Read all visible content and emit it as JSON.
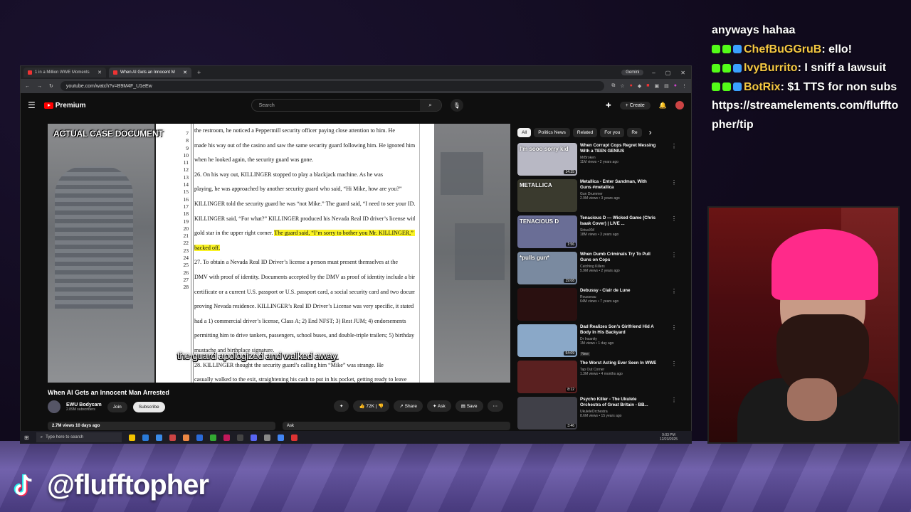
{
  "browser": {
    "tabs": [
      {
        "label": "1 in a Million WWE Moments",
        "active": false
      },
      {
        "label": "When AI Gets an Innocent M",
        "active": true
      }
    ],
    "gemini_label": "Gemini",
    "url": "youtube.com/watch?v=B9M4F_U1eEw"
  },
  "youtube": {
    "premium_label": "Premium",
    "search_placeholder": "Search",
    "create_label": "Create"
  },
  "video": {
    "overlay_label": "ACTUAL CASE DOCUMENT",
    "caption": "the guard apologized and walked away.",
    "document_line_numbers": [
      "7",
      "8",
      "9",
      "10",
      "11",
      "12",
      "13",
      "14",
      "15",
      "16",
      "17",
      "18",
      "19",
      "20",
      "21",
      "22",
      "23",
      "24",
      "25",
      "26",
      "27",
      "28"
    ],
    "document_lines": [
      {
        "text": "the restroom, he noticed a Peppermill security officer paying close attention to him. He",
        "hl": false
      },
      {
        "text": "made his way out of the casino and saw the same security guard following him. He ignored him and",
        "hl": false
      },
      {
        "text": "when he looked again, the security guard was gone.",
        "hl": false
      },
      {
        "text": "        26.    On his way out, KILLINGER stopped to play a blackjack machine. As he was",
        "hl": false
      },
      {
        "text": "playing, he was approached by another security guard who said, “Hi Mike, how are you?”",
        "hl": false
      },
      {
        "text": "KILLINGER told the security guard he was “not Mike.” The guard said, “I need to see your ID.”",
        "hl": false
      },
      {
        "text": "KILLINGER said, “For what?” KILLINGER produced his Nevada Real ID driver’s license with the",
        "hl": false
      },
      {
        "text": "gold star in the upper right corner. ",
        "hl_tail": "The guard said, “I’m sorry to bother you Mr. KILLINGER,” and"
      },
      {
        "text": "",
        "hl_tail": "backed off."
      },
      {
        "text": "        27.    To obtain a Nevada Real ID Driver’s license a person must present themselves at the",
        "hl": false
      },
      {
        "text": "DMV with proof of identity. Documents accepted by the DMV as proof of identity include a birth",
        "hl": false
      },
      {
        "text": "certificate or a current U.S. passport or U.S. passport card, a social security card and two documents",
        "hl": false
      },
      {
        "text": "proving Nevada residence. KILLINGER’s Real ID Driver’s License was very specific, it stated he",
        "hl": false
      },
      {
        "text": "had a 1) commercial driver’s license, Class A; 2) End NFST; 3) Rest JUM; 4) endorsements",
        "hl": false
      },
      {
        "text": "permitting him to drive tankers, passengers, school buses, and double-triple trailers; 5) birthday on",
        "hl": false
      },
      {
        "text": "                        mustache and birthplace signature.",
        "hl": false
      },
      {
        "text": "        28.    KILLINGER thought the security guard’s calling him “Mike” was strange. He",
        "hl": false
      },
      {
        "text": "casually walked to the exit, straightening his cash to put in his pocket, getting ready to leave",
        "hl": false
      }
    ],
    "title": "When AI Gets an Innocent Man Arrested",
    "channel": "EWU Bodycam",
    "subscribers": "2.89M subscribers",
    "join_label": "Join",
    "subscribe_label": "Subscribe",
    "likes": "72K",
    "share_label": "Share",
    "ask_label": "Ask",
    "save_label": "Save",
    "views_line": "2.7M views  10 days ago",
    "ask_bar": "Ask"
  },
  "chips": [
    "All",
    "Politics News",
    "Related",
    "For you",
    "Re"
  ],
  "recommendations": [
    {
      "title": "When Corrupt Cops Regret Messing With a TEEN GENIUS",
      "channel": "MrBroken",
      "meta": "11M views • 2 years ago",
      "duration": "14:35",
      "thumb_color": "#b8b8c4",
      "thumb_text": "I'm sooo sorry kid"
    },
    {
      "title": "Metallica - Enter Sandman, With Guns #metallica",
      "channel": "Gun Drummer",
      "meta": "2.9M views • 3 years ago",
      "duration": "",
      "thumb_color": "#3a3a2e",
      "thumb_text": "METALLICA"
    },
    {
      "title": "Tenacious D — Wicked Game (Chris Isaak Cover) | LIVE ...",
      "channel": "SiriusXM",
      "meta": "18M views • 3 years ago",
      "duration": "1:56",
      "thumb_color": "#6a6e96",
      "thumb_text": "TENACIOUS D"
    },
    {
      "title": "When Dumb Criminals Try To Pull Guns on Cops",
      "channel": "Catching Killers",
      "meta": "5.9M views • 2 years ago",
      "duration": "19:08",
      "thumb_color": "#7a8aa0",
      "thumb_text": "*pulls gun*"
    },
    {
      "title": "Debussy - Clair de Lune",
      "channel": "Rousseau",
      "meta": "64M views • 7 years ago",
      "duration": "",
      "thumb_color": "#2a1010",
      "thumb_text": ""
    },
    {
      "title": "Dad Realizes Son's Girlfriend Hid A Body In His Backyard",
      "channel": "Dr Insanity",
      "meta": "1M views • 1 day ago",
      "duration": "54:09",
      "thumb_color": "#8aa8c8",
      "thumb_text": "",
      "badge": "New"
    },
    {
      "title": "The Worst Acting Ever Seen In WWE",
      "channel": "Tap Out Corner",
      "meta": "1.3M views • 4 months ago",
      "duration": "8:12",
      "thumb_color": "#5a2020",
      "thumb_text": ""
    },
    {
      "title": "Psycho Killer - The Ukulele Orchestra of Great Britain - BB...",
      "channel": "UkuleleOrchestra",
      "meta": "8.6M views • 15 years ago",
      "duration": "3:46",
      "thumb_color": "#404048",
      "thumb_text": ""
    }
  ],
  "taskbar": {
    "search_placeholder": "Type here to search",
    "time": "9:03 PM",
    "date": "12/23/2025"
  },
  "chat": [
    {
      "user": "",
      "message": "anyways hahaa"
    },
    {
      "user": "ChefBuGGruB",
      "message": ": ello!"
    },
    {
      "user": "IvyBurrito",
      "message": ": I sniff a lawsuit"
    },
    {
      "user": "BotRix",
      "message": ": $1 TTS for non subs https://streamelements.com/flufftopher/tip"
    }
  ],
  "tiktok_handle": "@flufftopher",
  "colors": {
    "accent": "#ff0000",
    "chat_name": "#f5c842",
    "highlight": "#f9f224",
    "beanie": "#ff2a8a"
  }
}
